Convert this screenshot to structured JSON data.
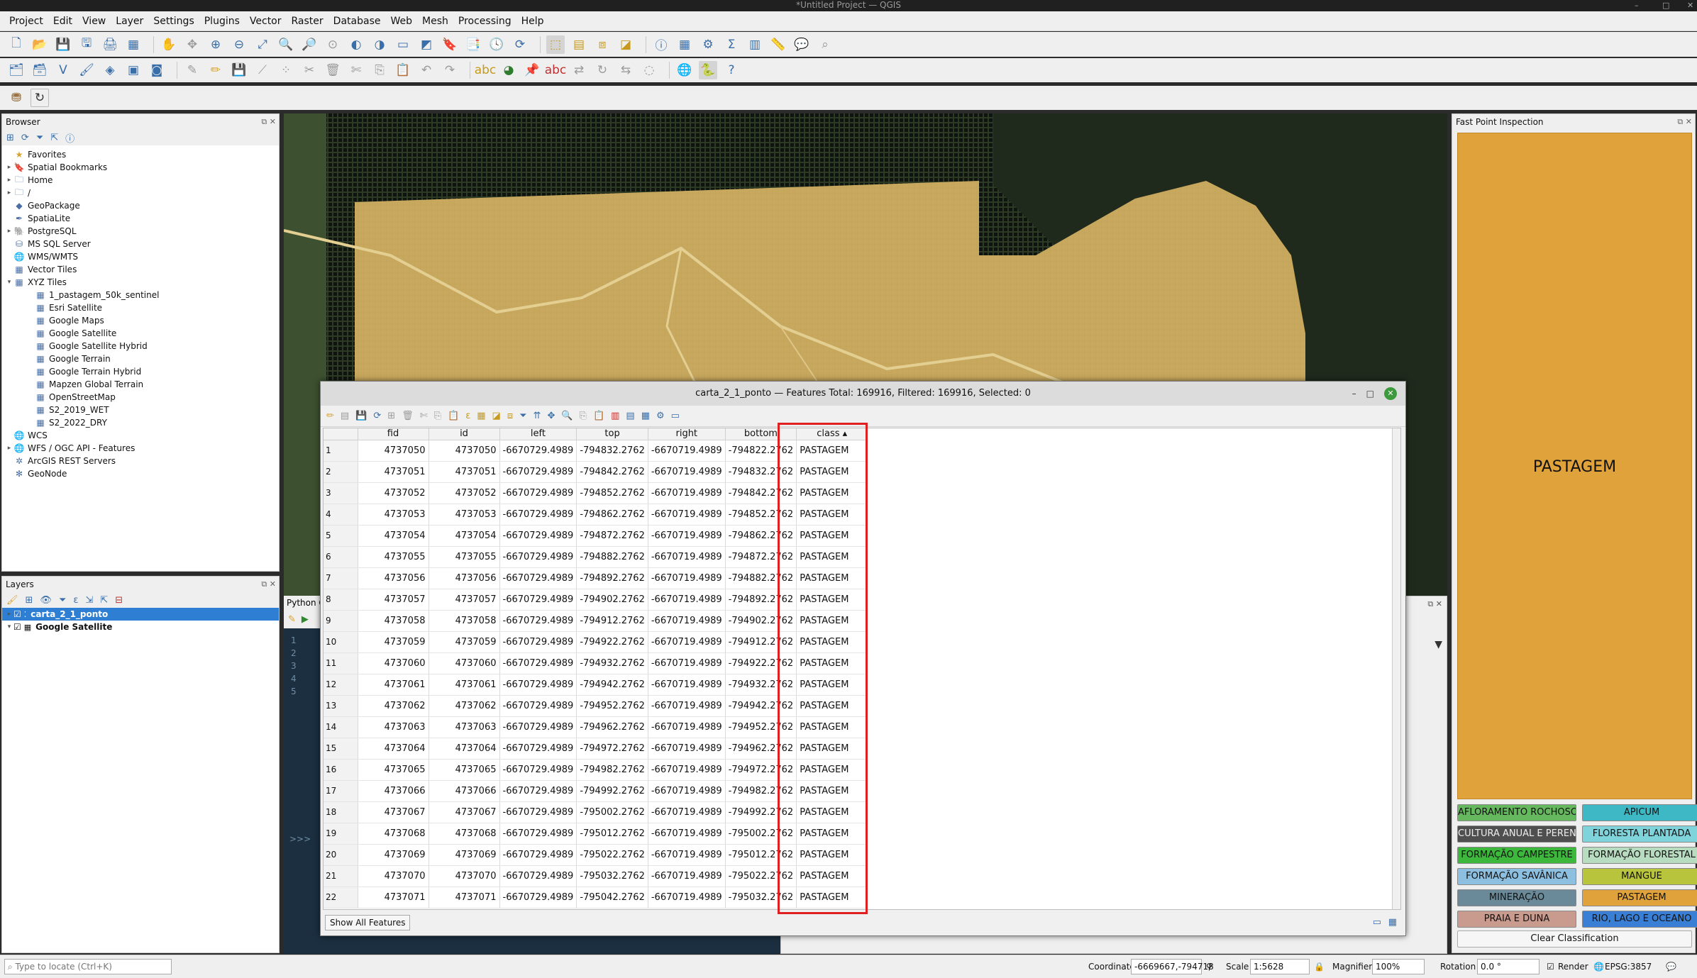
{
  "window": {
    "title": "*Untitled Project — QGIS"
  },
  "menu": [
    "Project",
    "Edit",
    "View",
    "Layer",
    "Settings",
    "Plugins",
    "Vector",
    "Raster",
    "Database",
    "Web",
    "Mesh",
    "Processing",
    "Help"
  ],
  "browser": {
    "title": "Browser",
    "items": [
      {
        "label": "Favorites",
        "icon": "star-icon",
        "level": 0,
        "exp": ""
      },
      {
        "label": "Spatial Bookmarks",
        "icon": "bookmark-icon",
        "level": 0,
        "exp": "▸"
      },
      {
        "label": "Home",
        "icon": "folder-icon",
        "level": 0,
        "exp": "▸"
      },
      {
        "label": "/",
        "icon": "folder-icon",
        "level": 0,
        "exp": "▸"
      },
      {
        "label": "GeoPackage",
        "icon": "geopackage-icon",
        "level": 0,
        "exp": ""
      },
      {
        "label": "SpatiaLite",
        "icon": "spatialite-icon",
        "level": 0,
        "exp": ""
      },
      {
        "label": "PostgreSQL",
        "icon": "postgresql-icon",
        "level": 0,
        "exp": "▸"
      },
      {
        "label": "MS SQL Server",
        "icon": "mssql-icon",
        "level": 0,
        "exp": ""
      },
      {
        "label": "WMS/WMTS",
        "icon": "globe-icon",
        "level": 0,
        "exp": ""
      },
      {
        "label": "Vector Tiles",
        "icon": "grid-icon",
        "level": 0,
        "exp": ""
      },
      {
        "label": "XYZ Tiles",
        "icon": "grid-icon",
        "level": 0,
        "exp": "▾"
      },
      {
        "label": "1_pastagem_50k_sentinel",
        "icon": "grid-icon",
        "level": 1,
        "exp": ""
      },
      {
        "label": "Esri Satellite",
        "icon": "grid-icon",
        "level": 1,
        "exp": ""
      },
      {
        "label": "Google Maps",
        "icon": "grid-icon",
        "level": 1,
        "exp": ""
      },
      {
        "label": "Google Satellite",
        "icon": "grid-icon",
        "level": 1,
        "exp": ""
      },
      {
        "label": "Google Satellite Hybrid",
        "icon": "grid-icon",
        "level": 1,
        "exp": ""
      },
      {
        "label": "Google Terrain",
        "icon": "grid-icon",
        "level": 1,
        "exp": ""
      },
      {
        "label": "Google Terrain Hybrid",
        "icon": "grid-icon",
        "level": 1,
        "exp": ""
      },
      {
        "label": "Mapzen Global Terrain",
        "icon": "grid-icon",
        "level": 1,
        "exp": ""
      },
      {
        "label": "OpenStreetMap",
        "icon": "grid-icon",
        "level": 1,
        "exp": ""
      },
      {
        "label": "S2_2019_WET",
        "icon": "grid-icon",
        "level": 1,
        "exp": ""
      },
      {
        "label": "S2_2022_DRY",
        "icon": "grid-icon",
        "level": 1,
        "exp": ""
      },
      {
        "label": "WCS",
        "icon": "globe-icon",
        "level": 0,
        "exp": ""
      },
      {
        "label": "WFS / OGC API - Features",
        "icon": "globe-icon",
        "level": 0,
        "exp": "▸"
      },
      {
        "label": "ArcGIS REST Servers",
        "icon": "arcgis-icon",
        "level": 0,
        "exp": ""
      },
      {
        "label": "GeoNode",
        "icon": "geonode-icon",
        "level": 0,
        "exp": ""
      }
    ]
  },
  "layers": {
    "title": "Layers",
    "items": [
      {
        "label": "carta_2_1_ponto",
        "selected": true
      },
      {
        "label": "Google Satellite",
        "selected": false
      }
    ]
  },
  "python": {
    "tab": "Python C",
    "lines": [
      "1",
      "2",
      "3",
      "4",
      "5"
    ],
    "prompt": ">>>"
  },
  "dialog": {
    "title": "carta_2_1_ponto — Features Total: 169916, Filtered: 169916, Selected: 0",
    "columns": [
      "fid",
      "id",
      "left",
      "top",
      "right",
      "bottom",
      "class"
    ],
    "rows": [
      [
        "1",
        "4737050",
        "4737050",
        "-6670729.4989",
        "-794832.2762",
        "-6670719.4989",
        "-794822.2762",
        "PASTAGEM"
      ],
      [
        "2",
        "4737051",
        "4737051",
        "-6670729.4989",
        "-794842.2762",
        "-6670719.4989",
        "-794832.2762",
        "PASTAGEM"
      ],
      [
        "3",
        "4737052",
        "4737052",
        "-6670729.4989",
        "-794852.2762",
        "-6670719.4989",
        "-794842.2762",
        "PASTAGEM"
      ],
      [
        "4",
        "4737053",
        "4737053",
        "-6670729.4989",
        "-794862.2762",
        "-6670719.4989",
        "-794852.2762",
        "PASTAGEM"
      ],
      [
        "5",
        "4737054",
        "4737054",
        "-6670729.4989",
        "-794872.2762",
        "-6670719.4989",
        "-794862.2762",
        "PASTAGEM"
      ],
      [
        "6",
        "4737055",
        "4737055",
        "-6670729.4989",
        "-794882.2762",
        "-6670719.4989",
        "-794872.2762",
        "PASTAGEM"
      ],
      [
        "7",
        "4737056",
        "4737056",
        "-6670729.4989",
        "-794892.2762",
        "-6670719.4989",
        "-794882.2762",
        "PASTAGEM"
      ],
      [
        "8",
        "4737057",
        "4737057",
        "-6670729.4989",
        "-794902.2762",
        "-6670719.4989",
        "-794892.2762",
        "PASTAGEM"
      ],
      [
        "9",
        "4737058",
        "4737058",
        "-6670729.4989",
        "-794912.2762",
        "-6670719.4989",
        "-794902.2762",
        "PASTAGEM"
      ],
      [
        "10",
        "4737059",
        "4737059",
        "-6670729.4989",
        "-794922.2762",
        "-6670719.4989",
        "-794912.2762",
        "PASTAGEM"
      ],
      [
        "11",
        "4737060",
        "4737060",
        "-6670729.4989",
        "-794932.2762",
        "-6670719.4989",
        "-794922.2762",
        "PASTAGEM"
      ],
      [
        "12",
        "4737061",
        "4737061",
        "-6670729.4989",
        "-794942.2762",
        "-6670719.4989",
        "-794932.2762",
        "PASTAGEM"
      ],
      [
        "13",
        "4737062",
        "4737062",
        "-6670729.4989",
        "-794952.2762",
        "-6670719.4989",
        "-794942.2762",
        "PASTAGEM"
      ],
      [
        "14",
        "4737063",
        "4737063",
        "-6670729.4989",
        "-794962.2762",
        "-6670719.4989",
        "-794952.2762",
        "PASTAGEM"
      ],
      [
        "15",
        "4737064",
        "4737064",
        "-6670729.4989",
        "-794972.2762",
        "-6670719.4989",
        "-794962.2762",
        "PASTAGEM"
      ],
      [
        "16",
        "4737065",
        "4737065",
        "-6670729.4989",
        "-794982.2762",
        "-6670719.4989",
        "-794972.2762",
        "PASTAGEM"
      ],
      [
        "17",
        "4737066",
        "4737066",
        "-6670729.4989",
        "-794992.2762",
        "-6670719.4989",
        "-794982.2762",
        "PASTAGEM"
      ],
      [
        "18",
        "4737067",
        "4737067",
        "-6670729.4989",
        "-795002.2762",
        "-6670719.4989",
        "-794992.2762",
        "PASTAGEM"
      ],
      [
        "19",
        "4737068",
        "4737068",
        "-6670729.4989",
        "-795012.2762",
        "-6670719.4989",
        "-795002.2762",
        "PASTAGEM"
      ],
      [
        "20",
        "4737069",
        "4737069",
        "-6670729.4989",
        "-795022.2762",
        "-6670719.4989",
        "-795012.2762",
        "PASTAGEM"
      ],
      [
        "21",
        "4737070",
        "4737070",
        "-6670729.4989",
        "-795032.2762",
        "-6670719.4989",
        "-795022.2762",
        "PASTAGEM"
      ],
      [
        "22",
        "4737071",
        "4737071",
        "-6670729.4989",
        "-795042.2762",
        "-6670719.4989",
        "-795032.2762",
        "PASTAGEM"
      ]
    ],
    "show_all": "Show All Features"
  },
  "fpi": {
    "title": "Fast Point Inspection",
    "current": "PASTAGEM",
    "current_color": "#e0a23b",
    "buttons": [
      {
        "label": "AFLORAMENTO ROCHOSO",
        "color": "#66b85e"
      },
      {
        "label": "APICUM",
        "color": "#3fb8c6"
      },
      {
        "label": "CULTURA ANUAL E PERENE",
        "color": "#4f4f4f"
      },
      {
        "label": "FLORESTA PLANTADA",
        "color": "#7fd3db"
      },
      {
        "label": "FORMAÇÃO CAMPESTRE",
        "color": "#3db83d"
      },
      {
        "label": "FORMAÇÃO FLORESTAL",
        "color": "#b8dcc0"
      },
      {
        "label": "FORMAÇÃO SAVÂNICA",
        "color": "#8cbfe0"
      },
      {
        "label": "MANGUE",
        "color": "#b8c43c"
      },
      {
        "label": "MINERAÇÃO",
        "color": "#6b8a99"
      },
      {
        "label": "PASTAGEM",
        "color": "#e0a23b"
      },
      {
        "label": "PRAIA E DUNA",
        "color": "#c99a8e"
      },
      {
        "label": "RIO, LAGO E OCEANO",
        "color": "#3a7fd6"
      }
    ],
    "clear": "Clear Classification"
  },
  "status": {
    "locate_placeholder": "Type to locate (Ctrl+K)",
    "coordinate_label": "Coordinate",
    "coordinate": "-6669667,-794718",
    "scale_label": "Scale",
    "scale": "1:5628",
    "magnifier_label": "Magnifier",
    "magnifier": "100%",
    "rotation_label": "Rotation",
    "rotation": "0.0 °",
    "render_label": "Render",
    "crs": "EPSG:3857"
  }
}
